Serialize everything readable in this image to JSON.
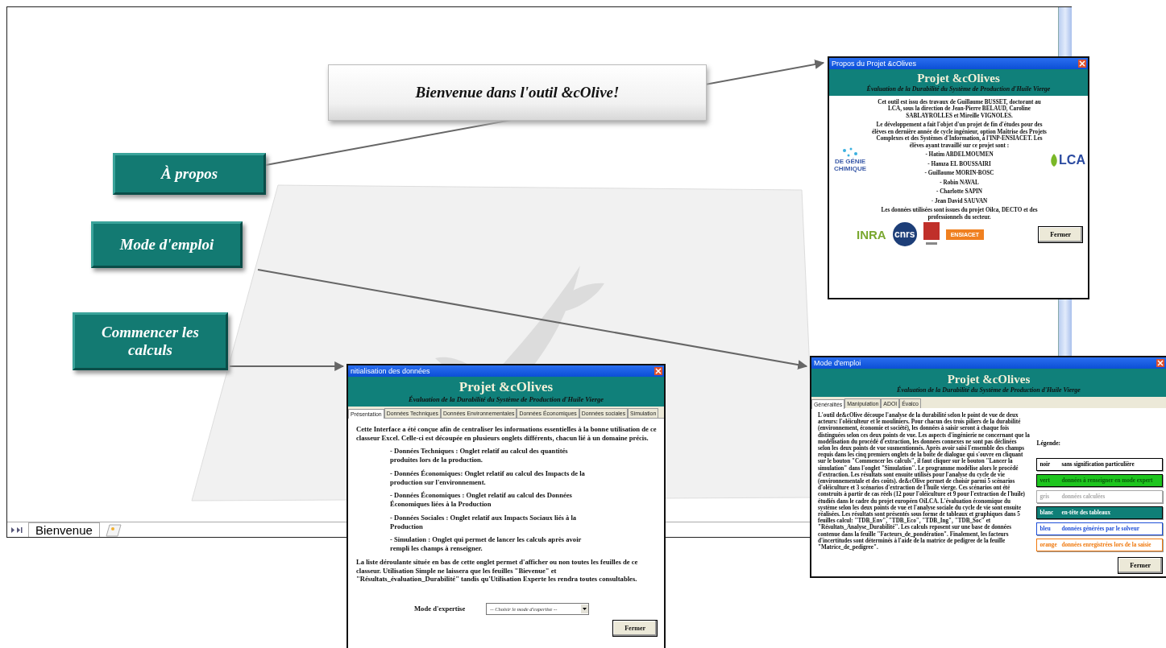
{
  "sheet": {
    "title_box": "Bienvenue dans l'outil &cOlive!",
    "buttons": [
      {
        "label": "À propos"
      },
      {
        "label": "Mode d'emploi"
      },
      {
        "label": "Commencer les calculs"
      }
    ],
    "sheet_tabs": [
      {
        "label": "Bienvenue",
        "selected": true
      }
    ]
  },
  "about_dialog": {
    "window_title": "Propos du Projet &cOlives",
    "title": "Projet &cOlives",
    "subtitle": "Évaluation de la Durabilité du Système de Production d'Huile Vierge",
    "paragraphs": [
      "Cet outil est issu des travaux de Guillaume BUSSET, doctorant au LCA, sous la direction de Jean-Pierre BELAUD, Caroline SABLAYROLLES et Mireille VIGNOLES.",
      "Le développement a fait l'objet d'un projet de fin d'études pour des élèves en dernière année de cycle ingénieur, option Maîtrise des Projets Complexes et des Systèmes d'Information, à l'INP-ENSIACET. Les élèves ayant travaillé sur ce projet sont :"
    ],
    "students": [
      "- Hatim ABDELMOUMEN",
      "- Hamza EL BOUSSAIRI",
      "- Guillaume MORIN-BOSC",
      "- Robin NAVAL",
      "- Charlotte SAPIN",
      "- Jean David SAUVAN"
    ],
    "closing": "Les données utilisées sont issues du projet Oilca, DECTO et des professionnels du secteur.",
    "logo_left": "DE GÉNIE CHIMIQUE",
    "logo_right": "LCA",
    "bottom_logos": [
      "INRA",
      "cnrs",
      "ENSIACET"
    ],
    "close_button": "Fermer"
  },
  "init_dialog": {
    "window_title": "nitialisation des données",
    "title": "Projet &cOlives",
    "subtitle": "Évaluation de la Durabilité du Système de Production d'Huile Vierge",
    "tabs": [
      {
        "label": "Présentation",
        "selected": true
      },
      {
        "label": "Données Techniques",
        "selected": false
      },
      {
        "label": "Données Environnementales",
        "selected": false
      },
      {
        "label": "Données Économiques",
        "selected": false
      },
      {
        "label": "Données sociales",
        "selected": false
      },
      {
        "label": "Simulation",
        "selected": false
      }
    ],
    "intro": "Cette Interface a été conçue afin de centraliser les informations essentielles à la bonne utilisation de ce classeur Excel. Celle-ci est découpée en plusieurs onglets différents, chacun lié à un domaine précis.",
    "bullets": [
      "- Données Techniques : Onglet relatif au calcul des quantités produites lors de la production.",
      "- Données Économiques: Onglet relatif au calcul des Impacts de la production sur l'environnement.",
      "- Données Économiques : Onglet relatif au calcul des Données Économiques liées à la Production",
      "- Données Sociales : Onglet relatif aux Impacts Sociaux liés à la Production",
      "- Simulation : Onglet qui permet de lancer les calculs après avoir rempli les champs à renseigner."
    ],
    "note": "La liste déroulante située en bas de cette onglet permet d'afficher ou non toutes les feuilles de ce classeur. Utilisation Simple ne laissera que les feuilles \"Bievenue\" et \"Résultats_évaluation_Durabilité\" tandis qu'Utilisation Experte les rendra toutes consultables.",
    "mode_label": "Mode d'expertise",
    "mode_select": {
      "placeholder": "-- Choisir le mode d'expertise --"
    },
    "close_button": "Fermer"
  },
  "help_dialog": {
    "window_title": "Mode d'emploi",
    "title": "Projet &cOlives",
    "subtitle": "Évaluation de la Durabilité du Système de Production d'Huile Vierge",
    "tabs": [
      {
        "label": "Généralités",
        "selected": true
      },
      {
        "label": "Manipulation",
        "selected": false
      },
      {
        "label": "ADOI",
        "selected": false
      },
      {
        "label": "Évalco",
        "selected": false
      }
    ],
    "text": "L'outil de&cOlive découpe l'analyse de la durabilité selon le point de vue de deux acteurs: l'oléiculteur et le mouliniers. Pour chacun des trois piliers de la durabilité (environnement, économie et société), les données à saisir seront à chaque fois distinguées selon ces deux points de vue. Les aspects d'ingénierie ne concernant que la modélisation du procédé d'extraction, les données connexes ne sont pas déclinées selon les deux points de vue susmentionnés. Après avoir saisi l'ensemble des champs requis dans les cinq premiers onglets de la boîte de dialogue qui s'ouvre en cliquant sur le bouton \"Commencer les calculs\", il faut cliquer sur le bouton \"Lancer la simulation\" dans l'onglet \"Simulation\". Le programme modélise alors le procédé d'extraction. Les résultats sont ensuite utilisés pour l'analyse du cycle de vie (environnementale et des coûts). de&cOlive permet de choisir parmi 5 scénarios d'oléiculture et 3 scénarios d'extraction de l'huile vierge. Ces scénarios ont été construits à partir de cas réels (12 pour l'oléiculture et 9 pour l'extraction de l'huile) étudiés dans le cadre du projet européen OiLCA. L'évaluation économique du système selon les deux points de vue et l'analyse sociale du cycle de vie sont ensuite réalisées. Les résultats sont présentés sous forme de tableaux et graphiques dans 5 feuilles calcul: \"TDB_Env\", \"TDB_Eco\", \"TDB_Ing\", \"TDB_Soc\" et \"Résultats_Analyse_Durabilité\". Les calculs reposent sur une base de données contenue dans la feuille \"Facteurs_de_pondération\". Finalement, les facteurs d'incertitudes sont déterminés à l'aide de la matrice de pedigree de la feuille \"Matrice_de_pedigree\".",
    "legend_title": "Légende:",
    "legend": [
      {
        "kind": "outline",
        "color": "#000000",
        "key": "noir",
        "meaning": "sans signification particulière"
      },
      {
        "kind": "filled",
        "color": "#1ec51e",
        "key": "vert",
        "meaning": "données à renseigner en mode expert"
      },
      {
        "kind": "outline",
        "color": "#a8a8a8",
        "key": "gris",
        "meaning": "données calculées"
      },
      {
        "kind": "filled",
        "color": "#0f7f77",
        "key": "blanc",
        "meaning": "en-tête des tableaux"
      },
      {
        "kind": "outline",
        "color": "#1f4fd8",
        "key": "bleu",
        "meaning": "données générées par le solveur"
      },
      {
        "kind": "outline",
        "color": "#f07a10",
        "key": "orange",
        "meaning": "données enregistrées lors de la saisie"
      }
    ],
    "close_button": "Fermer"
  }
}
